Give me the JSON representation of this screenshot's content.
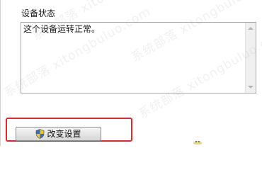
{
  "device_status": {
    "section_label": "设备状态",
    "status_text": "这个设备运转正常。"
  },
  "actions": {
    "change_settings_label": "改变设置"
  },
  "watermark": {
    "text": "系统部落 xitongbuluo.com"
  },
  "colors": {
    "highlight_border": "#e8262b",
    "text": "#111111"
  },
  "icons": {
    "button_icon": "uac-shield-icon",
    "scroll_up": "scroll-up-arrow-icon",
    "scroll_down": "scroll-down-arrow-icon"
  }
}
